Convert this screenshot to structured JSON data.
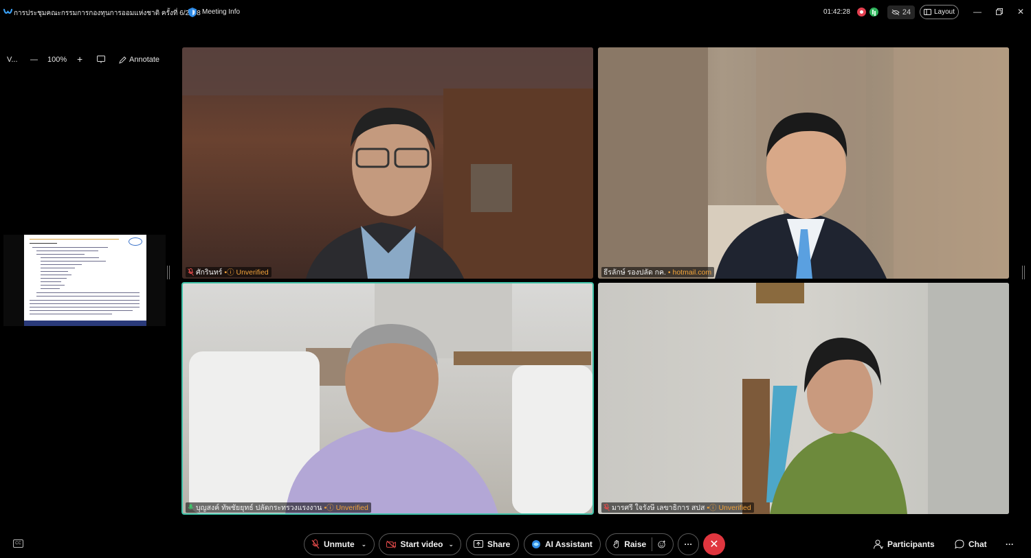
{
  "titlebar": {
    "meeting_title": "การประชุมคณะกรรมการกองทุนการออมแห่งชาติ ครั้งที่ 6/2568",
    "meeting_info": "Meeting Info",
    "timer": "01:42:28",
    "hidden_participants": "24",
    "layout_label": "Layout"
  },
  "toolbar": {
    "view_label": "V...",
    "zoom": "100%",
    "annotate_label": "Annotate"
  },
  "tiles": [
    {
      "name": "ศักรินทร์",
      "status": "Unverified",
      "muted": true
    },
    {
      "name": "ธีรลักษ์ รองปลัด กค.",
      "status": "hotmail.com",
      "muted": true
    },
    {
      "name": "บุญสงค์ ทัพชัยยุทธ์ ปลัดกระทรวงแรงงาน",
      "status": "Unverified",
      "muted": false
    },
    {
      "name": "มารศรี  ใจรังษี เลขาธิการ สปส",
      "status": "Unverified",
      "muted": true
    }
  ],
  "controls": {
    "unmute": "Unmute",
    "start_video": "Start video",
    "share": "Share",
    "ai_assistant": "AI Assistant",
    "raise": "Raise",
    "more": "···",
    "participants": "Participants",
    "chat": "Chat",
    "overflow": "···"
  },
  "colors": {
    "active_speaker": "#3fc3a9",
    "end_call": "#e0363f",
    "unverified": "#f2a33a",
    "muted_icon": "#e24a4a"
  }
}
